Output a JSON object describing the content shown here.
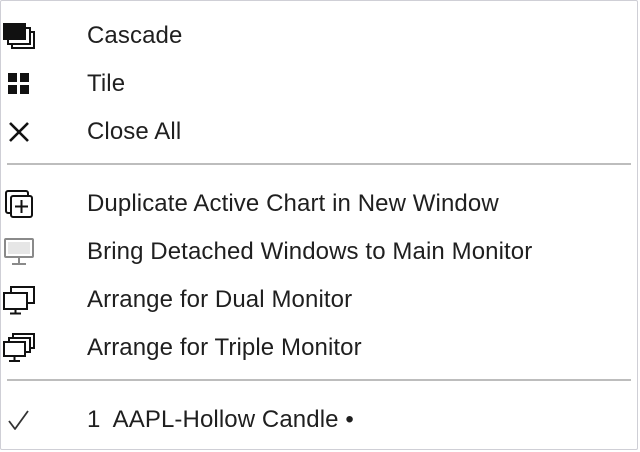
{
  "menu": {
    "items": [
      {
        "label": "Cascade",
        "icon": "cascade-icon"
      },
      {
        "label": "Tile",
        "icon": "tile-icon"
      },
      {
        "label": "Close All",
        "icon": "close-icon"
      },
      {
        "label": "Duplicate Active Chart in New Window",
        "icon": "duplicate-window-icon"
      },
      {
        "label": "Bring Detached Windows to Main Monitor",
        "icon": "monitor-icon"
      },
      {
        "label": "Arrange for Dual Monitor",
        "icon": "dual-monitor-icon"
      },
      {
        "label": "Arrange for Triple Monitor",
        "icon": "triple-monitor-icon"
      },
      {
        "label": "1  AAPL-Hollow Candle •",
        "icon": "checkmark-icon",
        "checked": true
      }
    ]
  },
  "colors": {
    "text": "#1f1f1f",
    "icon": "#111111",
    "icon_disabled": "#8a8a8a",
    "separator": "#bdbdbd"
  }
}
